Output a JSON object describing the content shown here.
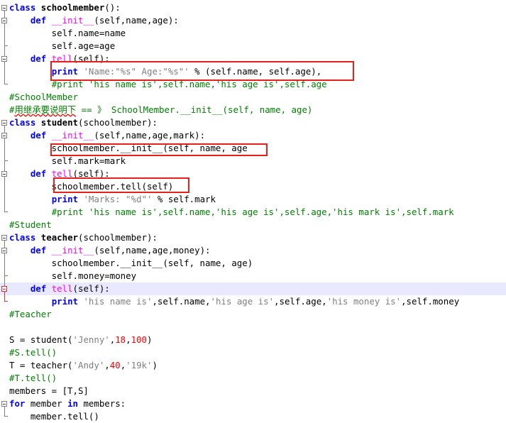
{
  "editor": {
    "highlight_color": "#e8201c",
    "lines": [
      {
        "segs": [
          {
            "c": "kw",
            "t": "class"
          },
          {
            "c": "",
            "t": " "
          },
          {
            "c": "fn",
            "t": "schoolmember"
          },
          {
            "c": "",
            "t": "():"
          }
        ]
      },
      {
        "segs": [
          {
            "c": "",
            "t": "    "
          },
          {
            "c": "kw",
            "t": "def"
          },
          {
            "c": "",
            "t": " "
          },
          {
            "c": "magic",
            "t": "__init__"
          },
          {
            "c": "",
            "t": "(self,name,age):"
          }
        ]
      },
      {
        "segs": [
          {
            "c": "",
            "t": "        self.name=name"
          }
        ]
      },
      {
        "segs": [
          {
            "c": "",
            "t": "        self.age=age"
          }
        ]
      },
      {
        "segs": [
          {
            "c": "",
            "t": "    "
          },
          {
            "c": "kw",
            "t": "def"
          },
          {
            "c": "",
            "t": " "
          },
          {
            "c": "magic",
            "t": "tell"
          },
          {
            "c": "",
            "t": "(self):"
          }
        ]
      },
      {
        "segs": [
          {
            "c": "",
            "t": "        "
          },
          {
            "c": "kw",
            "t": "print"
          },
          {
            "c": "",
            "t": " "
          },
          {
            "c": "str",
            "t": "'Name:\"%s\" Age:\"%s\"'"
          },
          {
            "c": "",
            "t": " % (self.name, self.age),"
          }
        ]
      },
      {
        "segs": [
          {
            "c": "",
            "t": "        "
          },
          {
            "c": "cmt",
            "t": "#print 'his name is',self.name,'his age is',self.age"
          }
        ]
      },
      {
        "segs": [
          {
            "c": "cmt",
            "t": "#SchoolMember"
          }
        ]
      },
      {
        "segs": [
          {
            "c": "cmt",
            "t": "#"
          },
          {
            "c": "cmt squig",
            "t": "用继承要说明下"
          },
          {
            "c": "cmt",
            "t": " == 》 SchoolMember.__init__(self, name, age)"
          }
        ]
      },
      {
        "segs": [
          {
            "c": "kw",
            "t": "class"
          },
          {
            "c": "",
            "t": " "
          },
          {
            "c": "fn",
            "t": "student"
          },
          {
            "c": "",
            "t": "(schoolmember):"
          }
        ]
      },
      {
        "segs": [
          {
            "c": "",
            "t": "    "
          },
          {
            "c": "kw",
            "t": "def"
          },
          {
            "c": "",
            "t": " "
          },
          {
            "c": "magic",
            "t": "__init__"
          },
          {
            "c": "",
            "t": "(self,name,age,mark):"
          }
        ]
      },
      {
        "segs": [
          {
            "c": "",
            "t": "        schoolmember.__init__(self, name, age"
          }
        ]
      },
      {
        "segs": [
          {
            "c": "",
            "t": "        self.mark=mark"
          }
        ]
      },
      {
        "segs": [
          {
            "c": "",
            "t": "    "
          },
          {
            "c": "kw",
            "t": "def"
          },
          {
            "c": "",
            "t": " "
          },
          {
            "c": "magic",
            "t": "tell"
          },
          {
            "c": "",
            "t": "(self):"
          }
        ]
      },
      {
        "segs": [
          {
            "c": "",
            "t": "        schoolmember.tell(self)"
          }
        ]
      },
      {
        "segs": [
          {
            "c": "",
            "t": "        "
          },
          {
            "c": "kw",
            "t": "print"
          },
          {
            "c": "",
            "t": " "
          },
          {
            "c": "str",
            "t": "'Marks: \"%d\"'"
          },
          {
            "c": "",
            "t": " % self.mark"
          }
        ]
      },
      {
        "segs": [
          {
            "c": "",
            "t": "        "
          },
          {
            "c": "cmt",
            "t": "#print 'his name is',self.name,'his age is',self.age,'his mark is',self.mark"
          }
        ]
      },
      {
        "segs": [
          {
            "c": "cmt",
            "t": "#Student"
          }
        ]
      },
      {
        "segs": [
          {
            "c": "kw",
            "t": "class"
          },
          {
            "c": "",
            "t": " "
          },
          {
            "c": "fn",
            "t": "teacher"
          },
          {
            "c": "",
            "t": "(schoolmember):"
          }
        ]
      },
      {
        "segs": [
          {
            "c": "",
            "t": "    "
          },
          {
            "c": "kw",
            "t": "def"
          },
          {
            "c": "",
            "t": " "
          },
          {
            "c": "magic",
            "t": "__init__"
          },
          {
            "c": "",
            "t": "(self,name,age,money):"
          }
        ]
      },
      {
        "segs": [
          {
            "c": "",
            "t": "        schoolmember.__init__(self, name, age)"
          }
        ]
      },
      {
        "segs": [
          {
            "c": "",
            "t": "        self.money=money"
          }
        ]
      },
      {
        "segs": [
          {
            "c": "",
            "t": "    "
          },
          {
            "c": "kw",
            "t": "def"
          },
          {
            "c": "",
            "t": " "
          },
          {
            "c": "magic",
            "t": "tell"
          },
          {
            "c": "",
            "t": "(self):"
          }
        ]
      },
      {
        "segs": [
          {
            "c": "",
            "t": "        "
          },
          {
            "c": "kw",
            "t": "print"
          },
          {
            "c": "",
            "t": " "
          },
          {
            "c": "str",
            "t": "'his name is'"
          },
          {
            "c": "",
            "t": ",self.name,"
          },
          {
            "c": "str",
            "t": "'his age is'"
          },
          {
            "c": "",
            "t": ",self.age,"
          },
          {
            "c": "str",
            "t": "'his money is'"
          },
          {
            "c": "",
            "t": ",self.money"
          }
        ]
      },
      {
        "segs": [
          {
            "c": "cmt",
            "t": "#Teacher"
          }
        ]
      },
      {
        "segs": [
          {
            "c": "",
            "t": ""
          }
        ]
      },
      {
        "segs": [
          {
            "c": "",
            "t": "S = student("
          },
          {
            "c": "str",
            "t": "'Jenny'"
          },
          {
            "c": "",
            "t": ","
          },
          {
            "c": "num",
            "t": "18"
          },
          {
            "c": "",
            "t": ","
          },
          {
            "c": "num",
            "t": "100"
          },
          {
            "c": "",
            "t": ")"
          }
        ]
      },
      {
        "segs": [
          {
            "c": "cmt",
            "t": "#S.tell()"
          }
        ]
      },
      {
        "segs": [
          {
            "c": "",
            "t": "T = teacher("
          },
          {
            "c": "str",
            "t": "'Andy'"
          },
          {
            "c": "",
            "t": ","
          },
          {
            "c": "num",
            "t": "40"
          },
          {
            "c": "",
            "t": ","
          },
          {
            "c": "str",
            "t": "'19k'"
          },
          {
            "c": "",
            "t": ")"
          }
        ]
      },
      {
        "segs": [
          {
            "c": "cmt",
            "t": "#T.tell()"
          }
        ]
      },
      {
        "segs": [
          {
            "c": "",
            "t": "members = [T,S]"
          }
        ]
      },
      {
        "segs": [
          {
            "c": "kw",
            "t": "for"
          },
          {
            "c": "",
            "t": " member "
          },
          {
            "c": "kw",
            "t": "in"
          },
          {
            "c": "",
            "t": " members:"
          }
        ]
      },
      {
        "segs": [
          {
            "c": "",
            "t": "    member.tell()"
          }
        ]
      }
    ]
  }
}
